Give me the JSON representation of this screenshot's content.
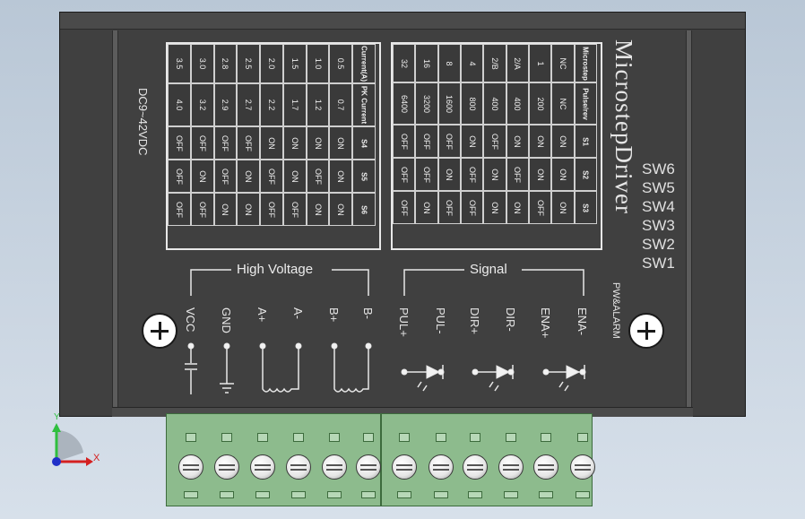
{
  "title": "MicrostepDriver",
  "voltage_label": "DC9~42VDC",
  "switch_labels": [
    "SW6",
    "SW5",
    "SW4",
    "SW3",
    "SW2",
    "SW1"
  ],
  "alarm_label": "PW&ALARM",
  "current_table": {
    "headers": [
      "Current(A)",
      "PK Current",
      "S4",
      "S5",
      "S6"
    ],
    "rows": [
      [
        "0.5",
        "0.7",
        "ON",
        "ON",
        "ON"
      ],
      [
        "1.0",
        "1.2",
        "ON",
        "OFF",
        "ON"
      ],
      [
        "1.5",
        "1.7",
        "ON",
        "ON",
        "OFF"
      ],
      [
        "2.0",
        "2.2",
        "ON",
        "OFF",
        "OFF"
      ],
      [
        "2.5",
        "2.7",
        "OFF",
        "ON",
        "ON"
      ],
      [
        "2.8",
        "2.9",
        "OFF",
        "OFF",
        "ON"
      ],
      [
        "3.0",
        "3.2",
        "OFF",
        "ON",
        "OFF"
      ],
      [
        "3.5",
        "4.0",
        "OFF",
        "OFF",
        "OFF"
      ]
    ]
  },
  "microstep_table": {
    "headers": [
      "Microstep",
      "Pulse/rev",
      "S1",
      "S2",
      "S3"
    ],
    "rows": [
      [
        "NC",
        "NC",
        "ON",
        "ON",
        "ON"
      ],
      [
        "1",
        "200",
        "ON",
        "ON",
        "OFF"
      ],
      [
        "2/A",
        "400",
        "ON",
        "OFF",
        "ON"
      ],
      [
        "2/B",
        "400",
        "OFF",
        "ON",
        "ON"
      ],
      [
        "4",
        "800",
        "ON",
        "OFF",
        "OFF"
      ],
      [
        "8",
        "1600",
        "OFF",
        "ON",
        "OFF"
      ],
      [
        "16",
        "3200",
        "OFF",
        "OFF",
        "ON"
      ],
      [
        "32",
        "6400",
        "OFF",
        "OFF",
        "OFF"
      ]
    ]
  },
  "group_high_voltage": "High Voltage",
  "group_signal": "Signal",
  "terminals": [
    "VCC",
    "GND",
    "A+",
    "A-",
    "B+",
    "B-",
    "PUL+",
    "PUL-",
    "DIR+",
    "DIR-",
    "ENA+",
    "ENA-"
  ],
  "axis": {
    "x": "X",
    "y": "Y"
  },
  "colors": {
    "body": "#404040",
    "connector": "#8dbb8d",
    "background": "#c9d5e2"
  }
}
